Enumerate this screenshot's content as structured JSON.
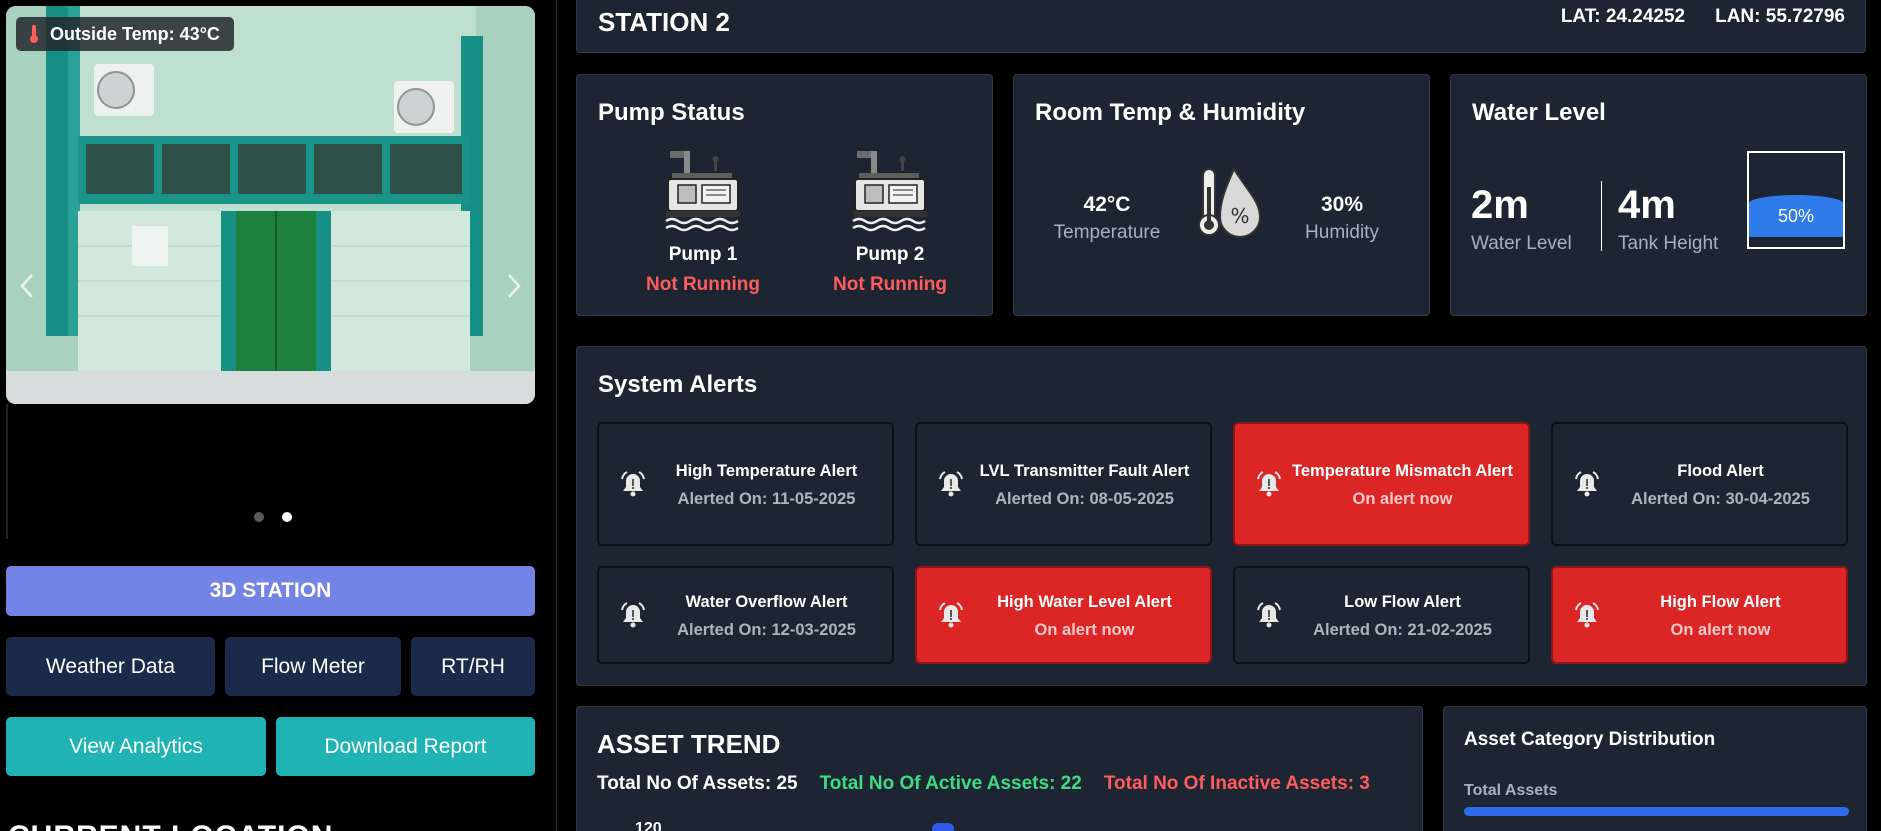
{
  "weather": {
    "outside_temp": "Outside Temp: 43°C"
  },
  "carousel": {
    "dots": 2,
    "active_dot": 1
  },
  "left_buttons": {
    "station_3d": "3D STATION",
    "weather_data": "Weather Data",
    "flow_meter": "Flow Meter",
    "rt_rh": "RT/RH",
    "view_analytics": "View Analytics",
    "download_report": "Download Report"
  },
  "left_heading": "CURRENT LOCATION",
  "station": {
    "title": "STATION 2",
    "lat": "LAT: 24.24252",
    "lan": "LAN: 55.72796"
  },
  "pump_status": {
    "title": "Pump Status",
    "pumps": [
      {
        "name": "Pump 1",
        "state": "Not Running"
      },
      {
        "name": "Pump 2",
        "state": "Not Running"
      }
    ]
  },
  "room": {
    "title": "Room Temp & Humidity",
    "temperature_value": "42°C",
    "temperature_label": "Temperature",
    "humidity_value": "30%",
    "humidity_label": "Humidity"
  },
  "water_level": {
    "title": "Water Level",
    "level_value": "2m",
    "level_label": "Water Level",
    "tank_height_value": "4m",
    "tank_height_label": "Tank Height",
    "fill_percent": 50,
    "fill_label": "50%"
  },
  "alerts": {
    "title": "System Alerts",
    "items": [
      {
        "title": "High Temperature Alert",
        "detail": "Alerted On: 11-05-2025",
        "active": false
      },
      {
        "title": "LVL Transmitter Fault Alert",
        "detail": "Alerted On: 08-05-2025",
        "active": false
      },
      {
        "title": "Temperature Mismatch Alert",
        "detail": "On alert now",
        "active": true
      },
      {
        "title": "Flood Alert",
        "detail": "Alerted On: 30-04-2025",
        "active": false
      },
      {
        "title": "Water Overflow Alert",
        "detail": "Alerted On: 12-03-2025",
        "active": false
      },
      {
        "title": "High Water Level Alert",
        "detail": "On alert now",
        "active": true
      },
      {
        "title": "Low Flow Alert",
        "detail": "Alerted On: 21-02-2025",
        "active": false
      },
      {
        "title": "High Flow Alert",
        "detail": "On alert now",
        "active": true
      }
    ]
  },
  "asset_trend": {
    "title": "ASSET TREND",
    "total": "Total No Of Assets: 25",
    "active": "Total No Of Active Assets: 22",
    "inactive": "Total No Of Inactive Assets: 3",
    "axis_top": "120"
  },
  "asset_distribution": {
    "title": "Asset Category Distribution",
    "total_label": "Total Assets"
  },
  "colors": {
    "accent_blue": "#7383e6",
    "teal": "#1fb3b4",
    "alert_red": "#dc2626",
    "panel": "#1e2532",
    "ok_green": "#3ddc84"
  }
}
